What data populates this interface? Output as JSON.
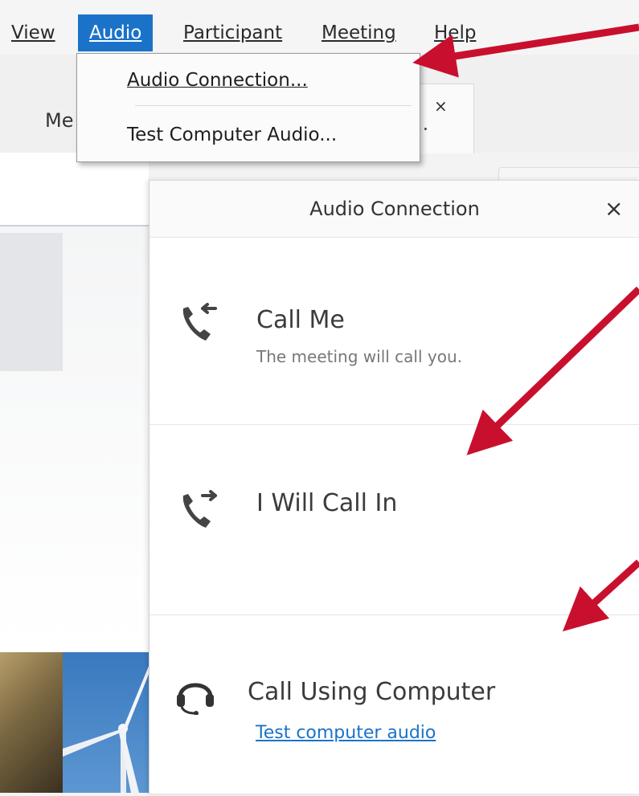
{
  "menubar": {
    "view": "View",
    "audio": "Audio",
    "participant": "Participant",
    "meeting": "Meeting",
    "help": "Help"
  },
  "tabs": {
    "me_fragment": "Me",
    "ellipsis": "..",
    "close": "×"
  },
  "dropdown": {
    "item_audio_connection": "Audio Connection...",
    "item_test_audio": "Test Computer Audio..."
  },
  "panel": {
    "title": "Audio Connection",
    "close": "×",
    "call_me_title": "Call Me",
    "call_me_sub": "The meeting will call you.",
    "call_in_title": "I Will Call In",
    "computer_title": "Call Using Computer",
    "computer_link": "Test computer audio"
  },
  "colors": {
    "accent": "#1a73c8",
    "arrow": "#c8102e"
  },
  "icons": {
    "call_me": "phone-incoming-icon",
    "call_in": "phone-outgoing-icon",
    "computer": "headset-icon",
    "close": "close-icon"
  }
}
